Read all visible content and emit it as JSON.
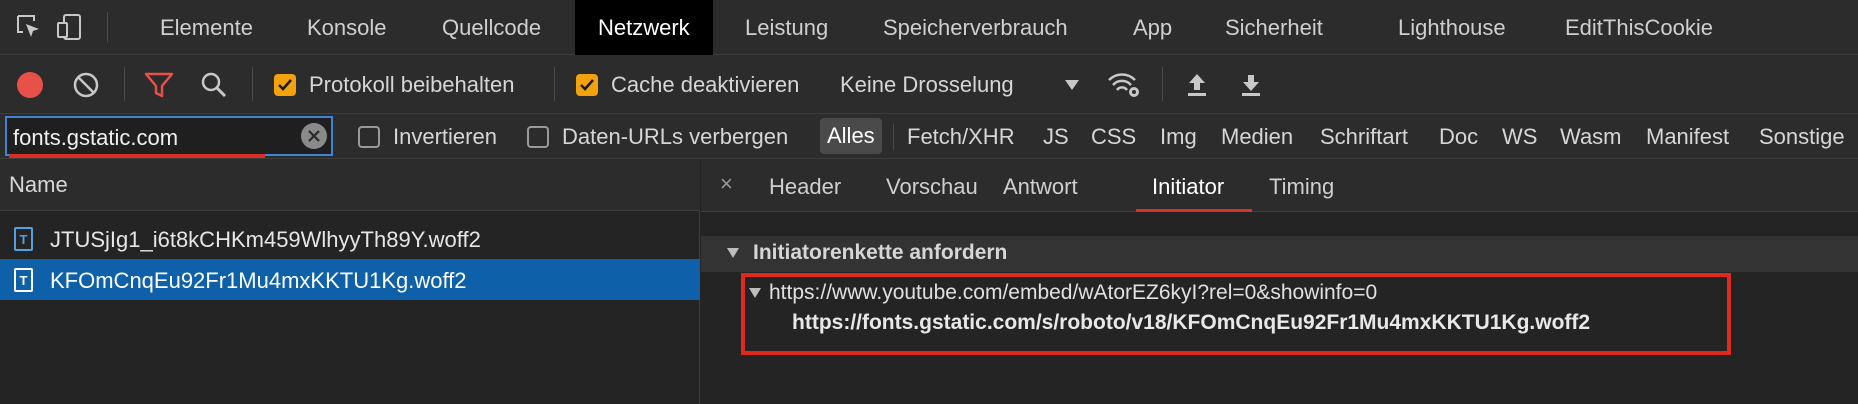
{
  "tabs": [
    {
      "label": "Elemente"
    },
    {
      "label": "Konsole"
    },
    {
      "label": "Quellcode"
    },
    {
      "label": "Netzwerk",
      "active": true
    },
    {
      "label": "Leistung"
    },
    {
      "label": "Speicherverbrauch"
    },
    {
      "label": "App"
    },
    {
      "label": "Sicherheit"
    },
    {
      "label": "Lighthouse"
    },
    {
      "label": "EditThisCookie"
    }
  ],
  "toolbar": {
    "preserve_log_label": "Protokoll beibehalten",
    "preserve_log_checked": true,
    "disable_cache_label": "Cache deaktivieren",
    "disable_cache_checked": true,
    "throttling_value": "Keine Drosselung"
  },
  "filter": {
    "value": "fonts.gstatic.com",
    "invert_label": "Invertieren",
    "hide_data_urls_label": "Daten-URLs verbergen",
    "types": [
      "Alles",
      "Fetch/XHR",
      "JS",
      "CSS",
      "Img",
      "Medien",
      "Schriftart",
      "Doc",
      "WS",
      "Wasm",
      "Manifest",
      "Sonstige"
    ],
    "active_type": "Alles"
  },
  "list": {
    "header": "Name",
    "file_icon_glyph": "T",
    "rows": [
      {
        "name": "JTUSjIg1_i6t8kCHKm459WlhyyTh89Y.woff2",
        "selected": false
      },
      {
        "name": "KFOmCnqEu92Fr1Mu4mxKKTU1Kg.woff2",
        "selected": true
      }
    ]
  },
  "detail": {
    "close_glyph": "×",
    "tabs": [
      {
        "label": "Header"
      },
      {
        "label": "Vorschau"
      },
      {
        "label": "Antwort"
      },
      {
        "label": "Initiator",
        "active": true
      },
      {
        "label": "Timing"
      }
    ],
    "section_title": "Initiatorenkette anfordern",
    "chain": {
      "initiator_url": "https://www.youtube.com/embed/wAtorEZ6kyI?rel=0&showinfo=0",
      "request_url": "https://fonts.gstatic.com/s/roboto/v18/KFOmCnqEu92Fr1Mu4mxKKTU1Kg.woff2"
    }
  },
  "icons": {
    "inspect": "inspect-element-icon",
    "device": "device-toolbar-icon",
    "record": "record-icon",
    "clear": "clear-icon",
    "filter": "filter-icon",
    "search": "search-icon",
    "dropdown": "dropdown-arrow-icon",
    "network_conditions": "network-conditions-icon",
    "import": "import-har-icon",
    "export": "export-har-icon"
  },
  "colors": {
    "accent_orange": "#f2a20c",
    "record_red": "#e8504a",
    "filter_red": "#e8504a",
    "selection_blue": "#0e60a8",
    "annotation_red": "#e0281d"
  }
}
